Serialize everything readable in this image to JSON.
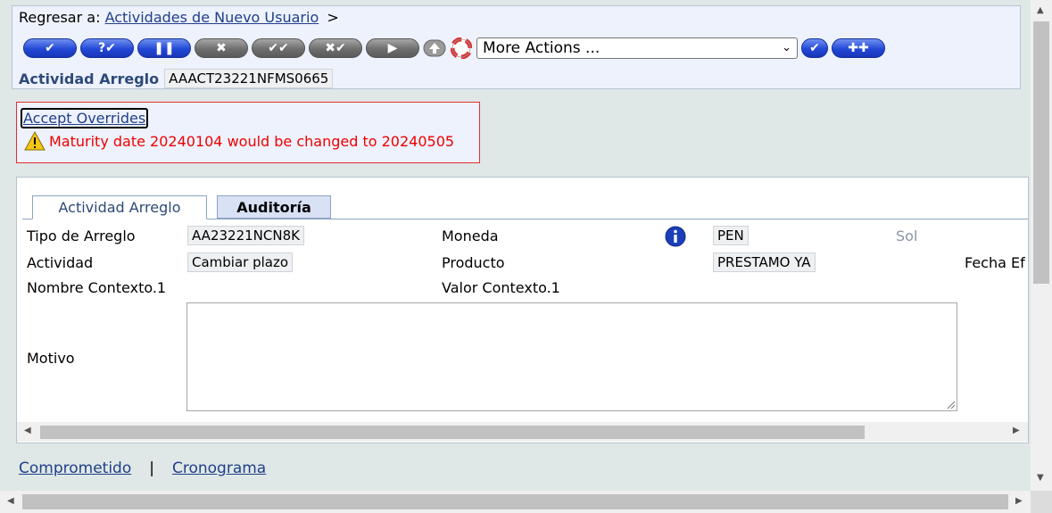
{
  "header": {
    "back_prefix": "Regresar a:",
    "back_link": "Actividades de Nuevo Usuario",
    "back_suffix": ">",
    "more_actions": "More Actions ...",
    "ref_label": "Actividad Arreglo",
    "ref_value": "AAACT23221NFMS0665"
  },
  "toolbar": {
    "icons": [
      "commit-icon",
      "validate-icon",
      "hold-icon",
      "delete-icon",
      "authorise-icon",
      "reverse-icon",
      "next-icon",
      "upload-icon",
      "help-icon",
      "go-icon",
      "new-deal-icon"
    ],
    "glyphs": {
      "commit": "✔",
      "validate": "?✔",
      "hold": "❚❚",
      "delete": "✖",
      "authorise": "✔✔",
      "reverse": "✖✔",
      "next": "▶",
      "go": "✔",
      "new": "✚✚"
    }
  },
  "overrides": {
    "accept_label": "Accept Overrides",
    "message": "Maturity date 20240104 would be changed to 20240505"
  },
  "tabs": [
    {
      "label": "Actividad Arreglo",
      "active": true
    },
    {
      "label": "Auditoría",
      "active": false
    }
  ],
  "form": {
    "tipo_label": "Tipo de Arreglo",
    "tipo_value": "AA23221NCN8K",
    "moneda_label": "Moneda",
    "moneda_value": "PEN",
    "moneda_unit": "Sol",
    "actividad_label": "Actividad",
    "actividad_value": "Cambiar plazo",
    "producto_label": "Producto",
    "producto_value": "PRESTAMO YA",
    "fecha_label": "Fecha Ef",
    "nombre_ctx_label": "Nombre Contexto.1",
    "valor_ctx_label": "Valor Contexto.1",
    "motivo_label": "Motivo",
    "motivo_value": ""
  },
  "footer": {
    "link1": "Comprometido",
    "separator": "|",
    "link2": "Cronograma"
  },
  "colors": {
    "accent": "#2248d6",
    "warning": "#e00000",
    "label_blue": "#2d4a79"
  }
}
